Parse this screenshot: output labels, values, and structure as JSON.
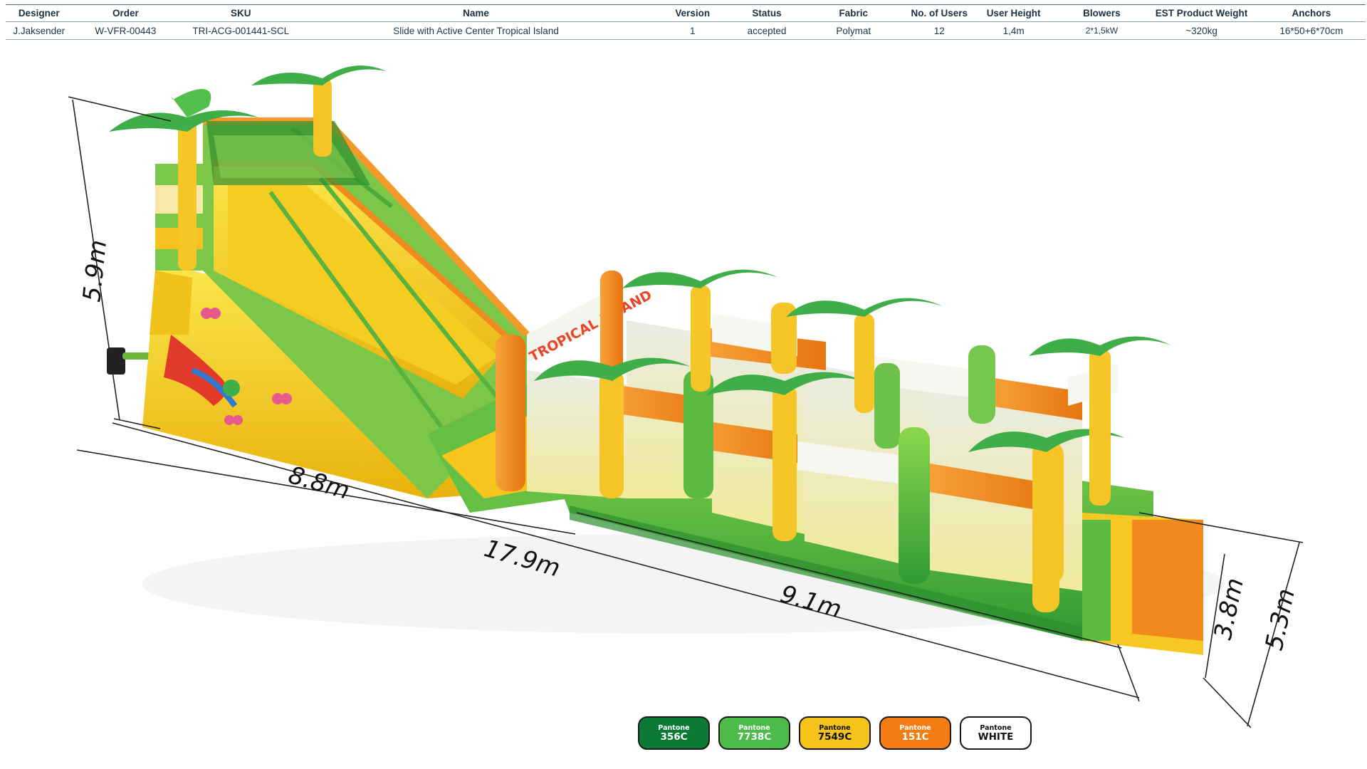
{
  "spec_table": {
    "headers": [
      "Designer",
      "Order",
      "SKU",
      "Name",
      "Version",
      "Status",
      "Fabric",
      "No. of Users",
      "User  Height",
      "Blowers",
      "EST Product Weight",
      "Anchors"
    ],
    "row": [
      "J.Jaksender",
      "W-VFR-00443",
      "TRI-ACG-001441-SCL",
      "Slide with Active Center Tropical Island",
      "1",
      "accepted",
      "Polymat",
      "12",
      "1,4m",
      "2*1,5kW",
      "~320kg",
      "16*50+6*70cm"
    ]
  },
  "dimensions": {
    "height": "5.9m",
    "slide_length": "8.8m",
    "total_length": "17.9m",
    "center_length": "9.1m",
    "inner_width": "3.8m",
    "outer_width": "5.3m"
  },
  "banner_text": "TROPICAL ISLAND",
  "pantone_swatches": [
    {
      "brand": "Pantone",
      "code": "356C",
      "color": "#0c7a34"
    },
    {
      "brand": "Pantone",
      "code": "7738C",
      "color": "#4cbb4a"
    },
    {
      "brand": "Pantone",
      "code": "7549C",
      "color": "#f7c31a"
    },
    {
      "brand": "Pantone",
      "code": "151C",
      "color": "#f47d14"
    },
    {
      "brand": "Pantone",
      "code": "WHITE",
      "color": "#ffffff"
    }
  ]
}
